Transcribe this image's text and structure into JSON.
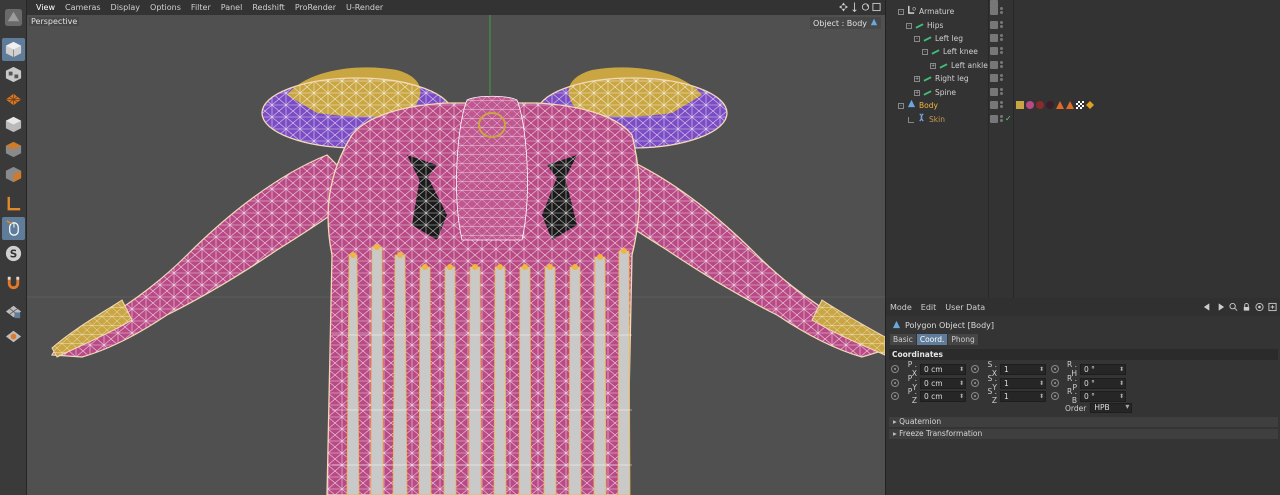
{
  "viewport": {
    "menu": [
      "View",
      "Cameras",
      "Display",
      "Options",
      "Filter",
      "Panel",
      "Redshift",
      "ProRender",
      "U-Render"
    ],
    "camera_label": "Perspective",
    "object_label": "Object : Body"
  },
  "object_manager": {
    "rows": [
      {
        "name": "Armature",
        "color": "#d0d0d0"
      },
      {
        "name": "Hips",
        "color": "#d0d0d0"
      },
      {
        "name": "Left leg",
        "color": "#d0d0d0"
      },
      {
        "name": "Left knee",
        "color": "#d0d0d0"
      },
      {
        "name": "Left ankle",
        "color": "#d0d0d0"
      },
      {
        "name": "Right leg",
        "color": "#d0d0d0"
      },
      {
        "name": "Spine",
        "color": "#d0d0d0"
      },
      {
        "name": "Body",
        "color": "#f0b640"
      },
      {
        "name": "Skin",
        "color": "#c89a50"
      }
    ]
  },
  "attribute_manager": {
    "menu": [
      "Mode",
      "Edit",
      "User Data"
    ],
    "object_title": "Polygon Object [Body]",
    "tabs": [
      {
        "label": "Basic",
        "active": false
      },
      {
        "label": "Coord.",
        "active": true
      },
      {
        "label": "Phong",
        "active": false
      }
    ],
    "section_title": "Coordinates",
    "coords": {
      "px_label": "P . X",
      "px_value": "0 cm",
      "py_label": "P . Y",
      "py_value": "0 cm",
      "pz_label": "P . Z",
      "pz_value": "0 cm",
      "sx_label": "S . X",
      "sx_value": "1",
      "sy_label": "S . Y",
      "sy_value": "1",
      "sz_label": "S . Z",
      "sz_value": "1",
      "rh_label": "R . H",
      "rh_value": "0 °",
      "rp_label": "R . P",
      "rp_value": "0 °",
      "rb_label": "R . B",
      "rb_value": "0 °"
    },
    "order_label": "Order",
    "order_value": "HPB",
    "collapsed_sections": [
      "Quaternion",
      "Freeze Transformation"
    ]
  },
  "colors": {
    "accent": "#5f7c9a",
    "mesh_pink": "#b94a86",
    "mesh_purple": "#7b4cc4",
    "mesh_gold": "#c9a642",
    "bone_gray": "#bdbdbd",
    "highlight_orange": "#f0b640"
  },
  "icons": [
    "cube-icon",
    "checker-cube-icon",
    "grid-icon",
    "polygon-icon",
    "edge-icon",
    "point-icon",
    "axis-icon",
    "mouse-icon",
    "snap-icon",
    "magnet-icon",
    "lock-grid-icon",
    "soft-selection-icon"
  ]
}
